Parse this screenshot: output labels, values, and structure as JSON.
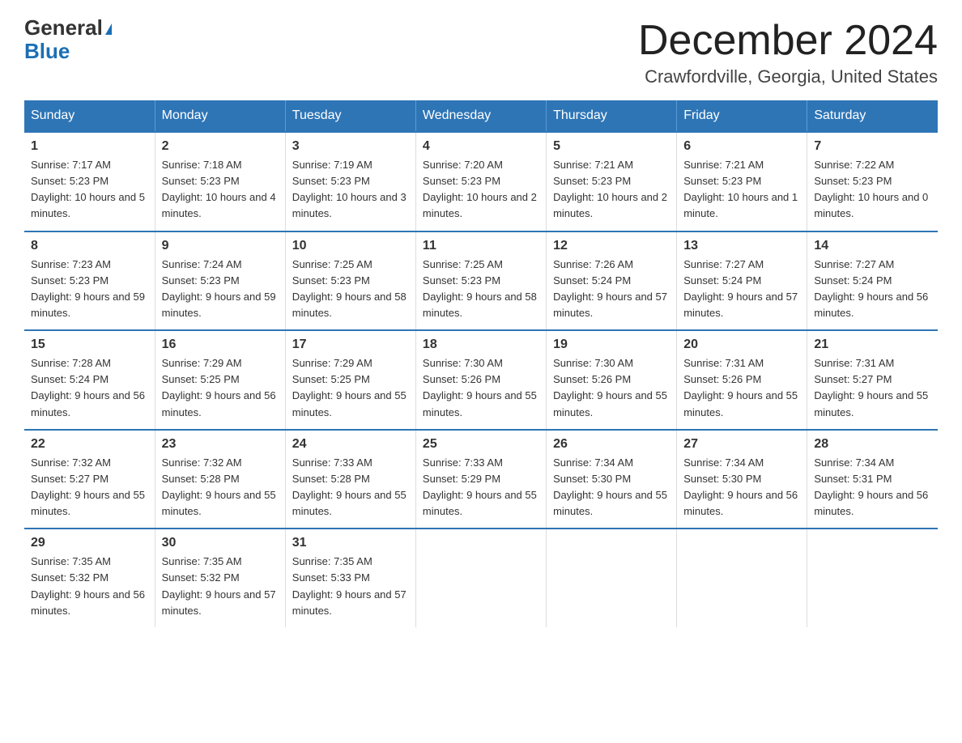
{
  "logo": {
    "line1": "General",
    "triangle": "▶",
    "line2": "Blue"
  },
  "header": {
    "month": "December 2024",
    "location": "Crawfordville, Georgia, United States"
  },
  "columns": [
    "Sunday",
    "Monday",
    "Tuesday",
    "Wednesday",
    "Thursday",
    "Friday",
    "Saturday"
  ],
  "weeks": [
    [
      {
        "day": "1",
        "sunrise": "7:17 AM",
        "sunset": "5:23 PM",
        "daylight": "10 hours and 5 minutes."
      },
      {
        "day": "2",
        "sunrise": "7:18 AM",
        "sunset": "5:23 PM",
        "daylight": "10 hours and 4 minutes."
      },
      {
        "day": "3",
        "sunrise": "7:19 AM",
        "sunset": "5:23 PM",
        "daylight": "10 hours and 3 minutes."
      },
      {
        "day": "4",
        "sunrise": "7:20 AM",
        "sunset": "5:23 PM",
        "daylight": "10 hours and 2 minutes."
      },
      {
        "day": "5",
        "sunrise": "7:21 AM",
        "sunset": "5:23 PM",
        "daylight": "10 hours and 2 minutes."
      },
      {
        "day": "6",
        "sunrise": "7:21 AM",
        "sunset": "5:23 PM",
        "daylight": "10 hours and 1 minute."
      },
      {
        "day": "7",
        "sunrise": "7:22 AM",
        "sunset": "5:23 PM",
        "daylight": "10 hours and 0 minutes."
      }
    ],
    [
      {
        "day": "8",
        "sunrise": "7:23 AM",
        "sunset": "5:23 PM",
        "daylight": "9 hours and 59 minutes."
      },
      {
        "day": "9",
        "sunrise": "7:24 AM",
        "sunset": "5:23 PM",
        "daylight": "9 hours and 59 minutes."
      },
      {
        "day": "10",
        "sunrise": "7:25 AM",
        "sunset": "5:23 PM",
        "daylight": "9 hours and 58 minutes."
      },
      {
        "day": "11",
        "sunrise": "7:25 AM",
        "sunset": "5:23 PM",
        "daylight": "9 hours and 58 minutes."
      },
      {
        "day": "12",
        "sunrise": "7:26 AM",
        "sunset": "5:24 PM",
        "daylight": "9 hours and 57 minutes."
      },
      {
        "day": "13",
        "sunrise": "7:27 AM",
        "sunset": "5:24 PM",
        "daylight": "9 hours and 57 minutes."
      },
      {
        "day": "14",
        "sunrise": "7:27 AM",
        "sunset": "5:24 PM",
        "daylight": "9 hours and 56 minutes."
      }
    ],
    [
      {
        "day": "15",
        "sunrise": "7:28 AM",
        "sunset": "5:24 PM",
        "daylight": "9 hours and 56 minutes."
      },
      {
        "day": "16",
        "sunrise": "7:29 AM",
        "sunset": "5:25 PM",
        "daylight": "9 hours and 56 minutes."
      },
      {
        "day": "17",
        "sunrise": "7:29 AM",
        "sunset": "5:25 PM",
        "daylight": "9 hours and 55 minutes."
      },
      {
        "day": "18",
        "sunrise": "7:30 AM",
        "sunset": "5:26 PM",
        "daylight": "9 hours and 55 minutes."
      },
      {
        "day": "19",
        "sunrise": "7:30 AM",
        "sunset": "5:26 PM",
        "daylight": "9 hours and 55 minutes."
      },
      {
        "day": "20",
        "sunrise": "7:31 AM",
        "sunset": "5:26 PM",
        "daylight": "9 hours and 55 minutes."
      },
      {
        "day": "21",
        "sunrise": "7:31 AM",
        "sunset": "5:27 PM",
        "daylight": "9 hours and 55 minutes."
      }
    ],
    [
      {
        "day": "22",
        "sunrise": "7:32 AM",
        "sunset": "5:27 PM",
        "daylight": "9 hours and 55 minutes."
      },
      {
        "day": "23",
        "sunrise": "7:32 AM",
        "sunset": "5:28 PM",
        "daylight": "9 hours and 55 minutes."
      },
      {
        "day": "24",
        "sunrise": "7:33 AM",
        "sunset": "5:28 PM",
        "daylight": "9 hours and 55 minutes."
      },
      {
        "day": "25",
        "sunrise": "7:33 AM",
        "sunset": "5:29 PM",
        "daylight": "9 hours and 55 minutes."
      },
      {
        "day": "26",
        "sunrise": "7:34 AM",
        "sunset": "5:30 PM",
        "daylight": "9 hours and 55 minutes."
      },
      {
        "day": "27",
        "sunrise": "7:34 AM",
        "sunset": "5:30 PM",
        "daylight": "9 hours and 56 minutes."
      },
      {
        "day": "28",
        "sunrise": "7:34 AM",
        "sunset": "5:31 PM",
        "daylight": "9 hours and 56 minutes."
      }
    ],
    [
      {
        "day": "29",
        "sunrise": "7:35 AM",
        "sunset": "5:32 PM",
        "daylight": "9 hours and 56 minutes."
      },
      {
        "day": "30",
        "sunrise": "7:35 AM",
        "sunset": "5:32 PM",
        "daylight": "9 hours and 57 minutes."
      },
      {
        "day": "31",
        "sunrise": "7:35 AM",
        "sunset": "5:33 PM",
        "daylight": "9 hours and 57 minutes."
      },
      null,
      null,
      null,
      null
    ]
  ],
  "labels": {
    "sunrise": "Sunrise:",
    "sunset": "Sunset:",
    "daylight": "Daylight:"
  }
}
